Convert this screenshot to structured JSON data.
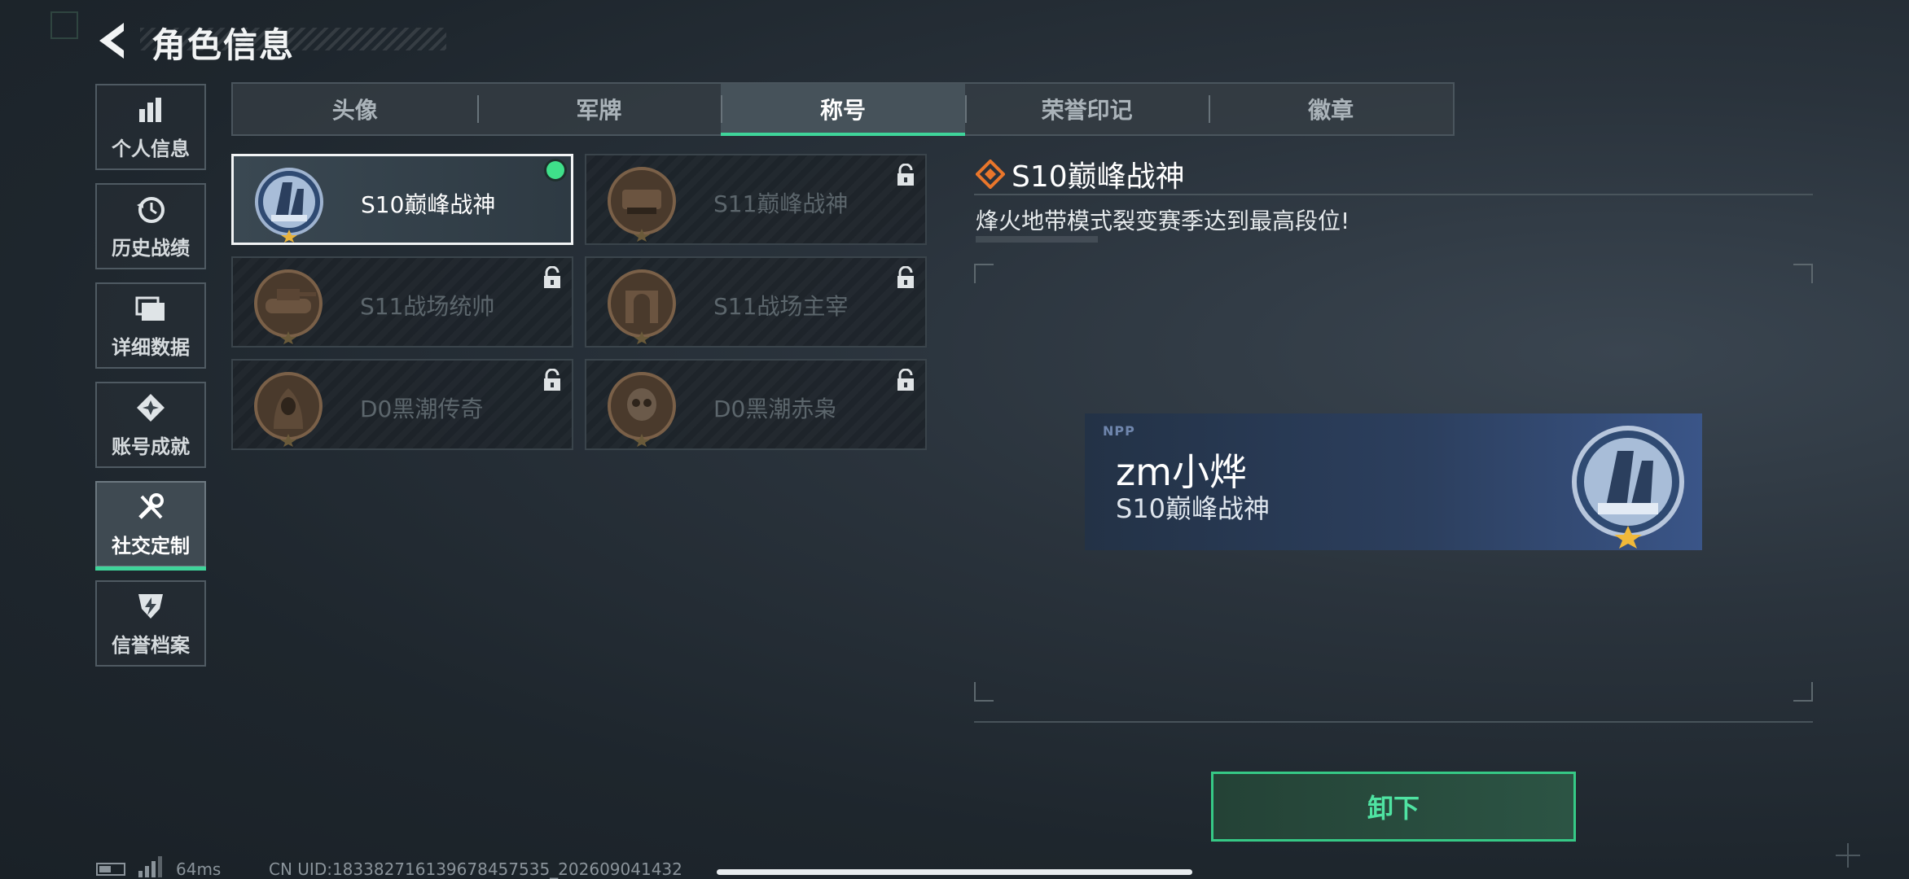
{
  "header": {
    "title": "角色信息"
  },
  "sidebar": {
    "items": [
      {
        "label": "个人信息",
        "icon": "bar-chart-icon"
      },
      {
        "label": "历史战绩",
        "icon": "history-clock-icon"
      },
      {
        "label": "详细数据",
        "icon": "folder-icon"
      },
      {
        "label": "账号成就",
        "icon": "achievement-icon"
      },
      {
        "label": "社交定制",
        "icon": "tools-icon",
        "active": true
      },
      {
        "label": "信誉档案",
        "icon": "credit-shield-icon"
      }
    ]
  },
  "tabs": [
    {
      "label": "头像"
    },
    {
      "label": "军牌"
    },
    {
      "label": "称号",
      "active": true
    },
    {
      "label": "荣誉印记"
    },
    {
      "label": "徽章"
    }
  ],
  "titles": [
    {
      "name": "S10巅峰战神",
      "selected": true,
      "equipped": true,
      "locked": false
    },
    {
      "name": "S11巅峰战神",
      "selected": false,
      "locked": true
    },
    {
      "name": "S11战场统帅",
      "selected": false,
      "locked": true
    },
    {
      "name": "S11战场主宰",
      "selected": false,
      "locked": true
    },
    {
      "name": "D0黑潮传奇",
      "selected": false,
      "locked": true
    },
    {
      "name": "D0黑潮赤枭",
      "selected": false,
      "locked": true
    }
  ],
  "detail": {
    "title": "S10巅峰战神",
    "description": "烽火地带模式裂变赛季达到最高段位!",
    "preview": {
      "player_name": "zm小烨",
      "title": "S10巅峰战神",
      "logo": "NPP"
    },
    "action": "卸下"
  },
  "footer": {
    "ping": "64ms",
    "uid": "CN UID:18338271613967845​7535_202609041432"
  },
  "colors": {
    "accent": "#3fd49a",
    "equipped_dot": "#3fe08a"
  }
}
